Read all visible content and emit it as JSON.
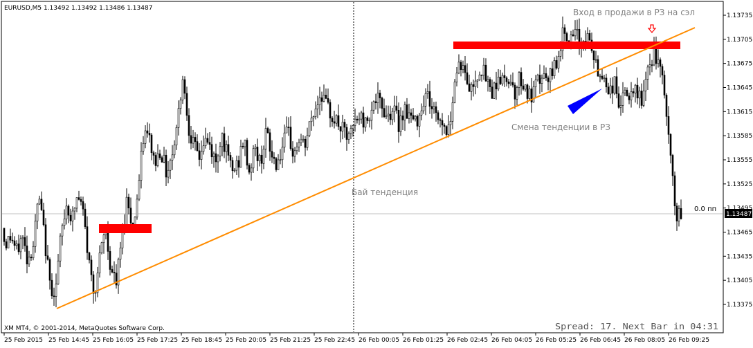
{
  "header": {
    "symbol_line": "EURUSD,M5  1.13492 1.13492 1.13486 1.13487"
  },
  "footer": {
    "copyright": "XM MT4, © 2001-2014, MetaQuotes Software Corp.",
    "spread_status": "Spread: 17. Next Bar in 04:31"
  },
  "annotations": {
    "entry_note": "Вход в продажи в РЗ на сэл",
    "trend_change": "Смена тенденции в РЗ",
    "buy_trend": "Бай тенденция",
    "zero_label": "0.0 пп"
  },
  "price_badge": "1.13487",
  "colors": {
    "candle": "#000000",
    "zone": "#ff0000",
    "trendline": "#ff8c00",
    "arrow": "#0000ff",
    "down_arrow": "#ff0000",
    "annotation_text": "#808080",
    "price_badge_bg": "#000000",
    "price_badge_text": "#ffffff"
  },
  "chart_data": {
    "type": "candlestick",
    "symbol": "EURUSD",
    "timeframe": "M5",
    "ylim": [
      1.13355,
      1.13745
    ],
    "y_ticks": [
      "1.13735",
      "1.13705",
      "1.13675",
      "1.13645",
      "1.13615",
      "1.13585",
      "1.13555",
      "1.13525",
      "1.13495",
      "1.13465",
      "1.13435",
      "1.13405",
      "1.13375"
    ],
    "x_ticks": [
      "25 Feb 2015",
      "25 Feb 14:45",
      "25 Feb 16:05",
      "25 Feb 17:25",
      "25 Feb 18:45",
      "25 Feb 20:05",
      "25 Feb 21:25",
      "25 Feb 22:45",
      "26 Feb 00:05",
      "26 Feb 01:25",
      "26 Feb 02:45",
      "26 Feb 04:05",
      "26 Feb 05:25",
      "26 Feb 06:45",
      "26 Feb 08:05",
      "26 Feb 09:25"
    ],
    "current_price": 1.13487,
    "price_path": [
      [
        0,
        1.1347
      ],
      [
        8,
        1.1345
      ],
      [
        16,
        1.1346
      ],
      [
        24,
        1.1344
      ],
      [
        32,
        1.1346
      ],
      [
        40,
        1.1343
      ],
      [
        48,
        1.1345
      ],
      [
        56,
        1.1351
      ],
      [
        64,
        1.1346
      ],
      [
        72,
        1.134
      ],
      [
        80,
        1.1339
      ],
      [
        88,
        1.1346
      ],
      [
        96,
        1.135
      ],
      [
        104,
        1.1348
      ],
      [
        112,
        1.1351
      ],
      [
        120,
        1.1349
      ],
      [
        128,
        1.1343
      ],
      [
        136,
        1.1339
      ],
      [
        144,
        1.1343
      ],
      [
        152,
        1.1347
      ],
      [
        160,
        1.1342
      ],
      [
        168,
        1.134
      ],
      [
        176,
        1.1346
      ],
      [
        184,
        1.1351
      ],
      [
        192,
        1.1347
      ],
      [
        200,
        1.1352
      ],
      [
        208,
        1.1359
      ],
      [
        216,
        1.1358
      ],
      [
        224,
        1.1355
      ],
      [
        232,
        1.1357
      ],
      [
        240,
        1.1354
      ],
      [
        248,
        1.1356
      ],
      [
        256,
        1.136
      ],
      [
        264,
        1.1366
      ],
      [
        272,
        1.136
      ],
      [
        280,
        1.1357
      ],
      [
        288,
        1.1356
      ],
      [
        296,
        1.1358
      ],
      [
        304,
        1.1357
      ],
      [
        312,
        1.1355
      ],
      [
        320,
        1.1359
      ],
      [
        328,
        1.1356
      ],
      [
        336,
        1.1354
      ],
      [
        344,
        1.1355
      ],
      [
        352,
        1.1358
      ],
      [
        360,
        1.1354
      ],
      [
        368,
        1.1357
      ],
      [
        376,
        1.1355
      ],
      [
        384,
        1.1359
      ],
      [
        392,
        1.1356
      ],
      [
        400,
        1.1355
      ],
      [
        408,
        1.1357
      ],
      [
        416,
        1.1359
      ],
      [
        424,
        1.1356
      ],
      [
        432,
        1.1358
      ],
      [
        440,
        1.1357
      ],
      [
        448,
        1.136
      ],
      [
        456,
        1.1362
      ],
      [
        464,
        1.1364
      ],
      [
        472,
        1.1362
      ],
      [
        480,
        1.1361
      ],
      [
        488,
        1.136
      ],
      [
        496,
        1.1359
      ],
      [
        504,
        1.1358
      ],
      [
        512,
        1.136
      ],
      [
        520,
        1.1361
      ],
      [
        528,
        1.136
      ],
      [
        536,
        1.1362
      ],
      [
        544,
        1.1363
      ],
      [
        552,
        1.1362
      ],
      [
        560,
        1.1361
      ],
      [
        568,
        1.1362
      ],
      [
        576,
        1.136
      ],
      [
        584,
        1.1362
      ],
      [
        592,
        1.1361
      ],
      [
        600,
        1.136
      ],
      [
        608,
        1.1362
      ],
      [
        616,
        1.1364
      ],
      [
        624,
        1.1362
      ],
      [
        632,
        1.1361
      ],
      [
        640,
        1.136
      ],
      [
        648,
        1.1359
      ],
      [
        656,
        1.1365
      ],
      [
        664,
        1.1368
      ],
      [
        672,
        1.1366
      ],
      [
        680,
        1.1364
      ],
      [
        688,
        1.1366
      ],
      [
        696,
        1.1367
      ],
      [
        704,
        1.1365
      ],
      [
        712,
        1.1364
      ],
      [
        720,
        1.1366
      ],
      [
        728,
        1.1365
      ],
      [
        736,
        1.1366
      ],
      [
        744,
        1.1364
      ],
      [
        752,
        1.1366
      ],
      [
        760,
        1.1364
      ],
      [
        768,
        1.1363
      ],
      [
        776,
        1.1365
      ],
      [
        784,
        1.1366
      ],
      [
        792,
        1.1365
      ],
      [
        800,
        1.1367
      ],
      [
        808,
        1.1369
      ],
      [
        816,
        1.1372
      ],
      [
        824,
        1.137
      ],
      [
        832,
        1.1371
      ],
      [
        840,
        1.137
      ],
      [
        848,
        1.1371
      ],
      [
        856,
        1.1369
      ],
      [
        864,
        1.1366
      ],
      [
        872,
        1.1366
      ],
      [
        880,
        1.1364
      ],
      [
        888,
        1.1365
      ],
      [
        896,
        1.1362
      ],
      [
        904,
        1.1364
      ],
      [
        912,
        1.1363
      ],
      [
        920,
        1.1364
      ],
      [
        928,
        1.1363
      ],
      [
        936,
        1.1366
      ],
      [
        944,
        1.1369
      ],
      [
        952,
        1.1367
      ],
      [
        960,
        1.1364
      ],
      [
        966,
        1.1358
      ],
      [
        972,
        1.1353
      ],
      [
        978,
        1.1348
      ],
      [
        984,
        1.13487
      ]
    ]
  }
}
